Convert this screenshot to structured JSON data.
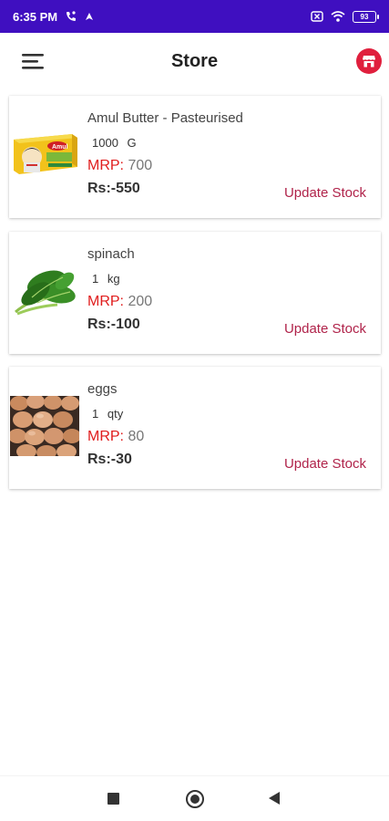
{
  "status": {
    "time": "6:35 PM",
    "battery": "93"
  },
  "app_bar": {
    "title": "Store"
  },
  "products": [
    {
      "name": "Amul Butter - Pasteurised",
      "quantity": "1000",
      "unit": "G",
      "mrp_label": "MRP:",
      "mrp_value": "700",
      "price": "Rs:-550",
      "action": "Update Stock",
      "image_icon": "butter-pack-image"
    },
    {
      "name": "spinach",
      "quantity": "1",
      "unit": "kg",
      "mrp_label": "MRP:",
      "mrp_value": "200",
      "price": "Rs:-100",
      "action": "Update Stock",
      "image_icon": "spinach-image"
    },
    {
      "name": "eggs",
      "quantity": "1",
      "unit": "qty",
      "mrp_label": "MRP:",
      "mrp_value": "80",
      "price": "Rs:-30",
      "action": "Update Stock",
      "image_icon": "eggs-image"
    }
  ],
  "colors": {
    "status_bar": "#3f0fc0",
    "accent_red": "#e01c1c",
    "action": "#b0234a",
    "store_icon_bg": "#e01f3d"
  }
}
